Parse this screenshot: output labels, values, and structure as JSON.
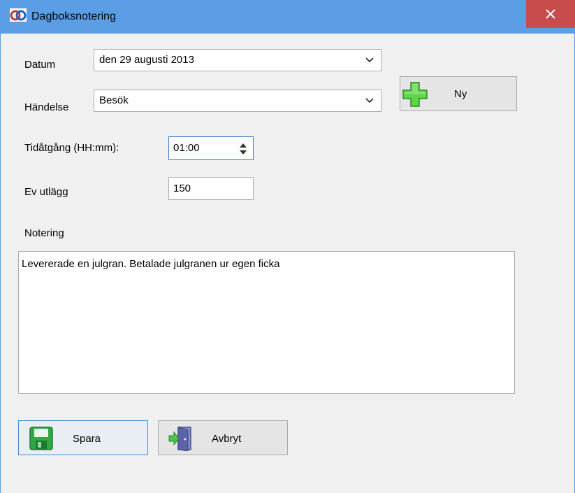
{
  "window": {
    "title": "Dagboksnotering",
    "close_icon": "close-icon"
  },
  "form": {
    "date_label": "Datum",
    "date_value": "den 29 augusti 2013",
    "event_label": "Händelse",
    "event_value": "Besök",
    "new_button_label": "Ny",
    "time_label": "Tidåtgång (HH:mm):",
    "time_value": "01:00",
    "expense_label": "Ev utlägg",
    "expense_value": "150",
    "note_label": "Notering",
    "note_value": "Levererade en julgran. Betalade julgranen ur egen ficka"
  },
  "actions": {
    "save_label": "Spara",
    "cancel_label": "Avbryt"
  },
  "icons": {
    "app": "app-logo-icon",
    "new": "green-plus-icon",
    "save": "floppy-disk-icon",
    "cancel": "exit-door-icon"
  },
  "colors": {
    "titlebar": "#5b9ee6",
    "close": "#c94c4c",
    "focus_border": "#3b79c9"
  }
}
